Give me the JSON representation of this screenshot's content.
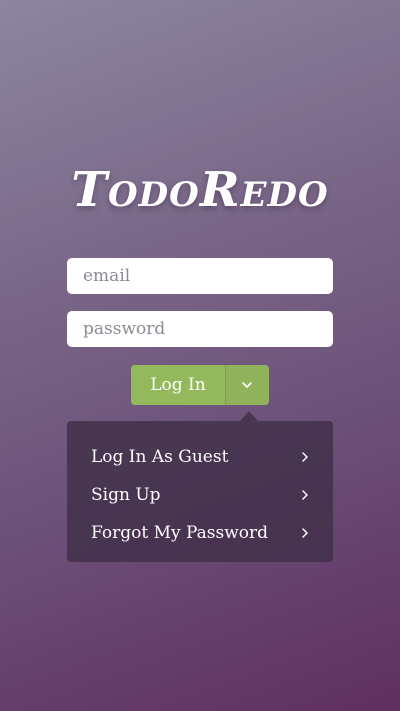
{
  "app": {
    "logo": "TodoRedo"
  },
  "form": {
    "email_placeholder": "email",
    "password_placeholder": "password",
    "login_label": "Log In",
    "dropdown_icon": "chevron-down-icon"
  },
  "menu": {
    "items": [
      {
        "label": "Log In As Guest",
        "icon": "chevron-right-icon"
      },
      {
        "label": "Sign Up",
        "icon": "chevron-right-icon"
      },
      {
        "label": "Forgot My Password",
        "icon": "chevron-right-icon"
      }
    ]
  },
  "colors": {
    "accent": "#94b85c",
    "menu_bg": "#413048"
  }
}
